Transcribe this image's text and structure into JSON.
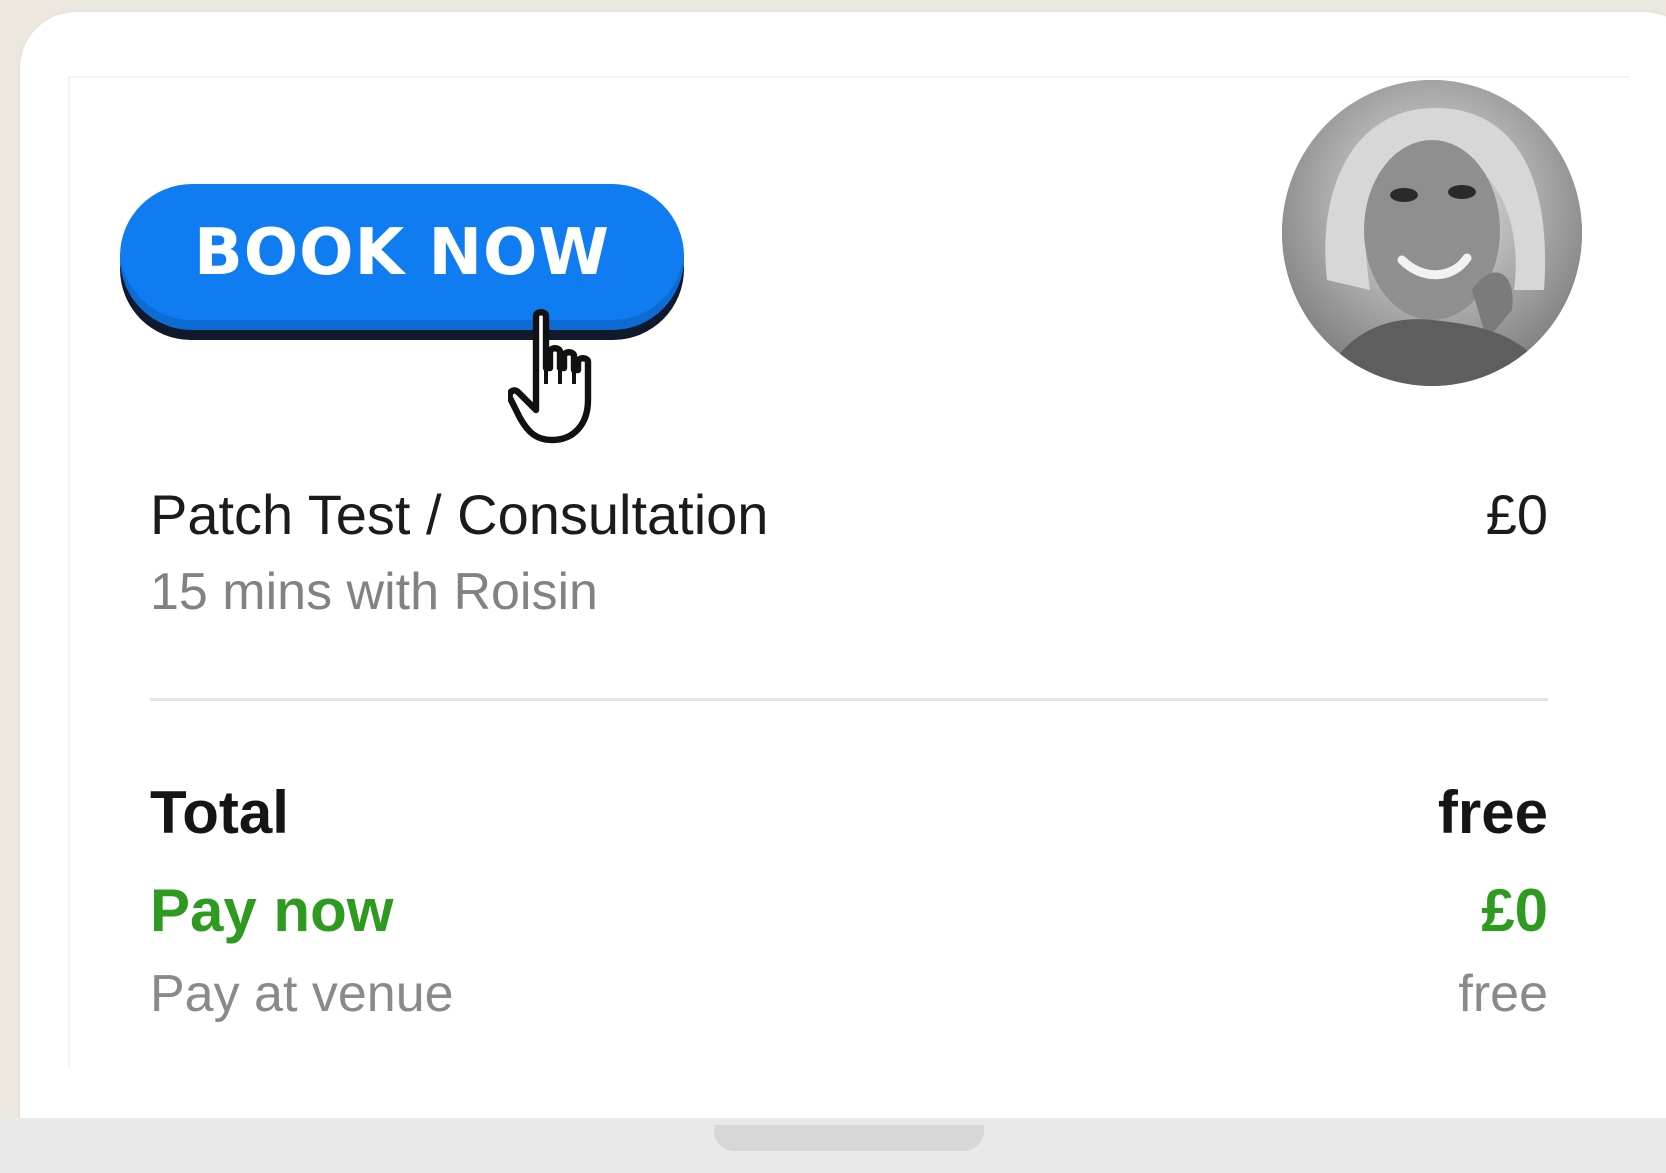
{
  "booking_button": {
    "label": "BOOK NOW",
    "color": "#0f7cf2"
  },
  "cursor": {
    "icon": "hand-pointer-icon"
  },
  "avatar": {
    "icon": "staff-avatar-photo"
  },
  "service": {
    "name": "Patch Test / Consultation",
    "price": "£0",
    "duration": "15 mins with Roisin"
  },
  "summary": {
    "total_label": "Total",
    "total_value": "free",
    "pay_now_label": "Pay now",
    "pay_now_value": "£0",
    "pay_now_color": "#2e9a1f",
    "pay_at_venue_label": "Pay at venue",
    "pay_at_venue_value": "free"
  }
}
